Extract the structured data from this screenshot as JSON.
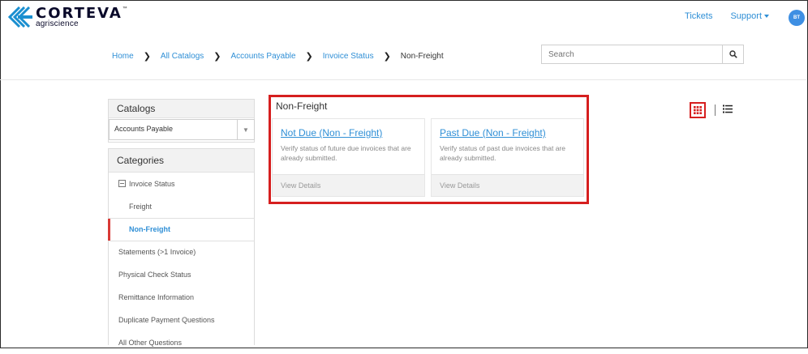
{
  "header": {
    "logo_name": "CORTEVA",
    "logo_tm": "™",
    "logo_sub": "agriscience",
    "tickets": "Tickets",
    "support": "Support",
    "avatar_initials": "BT"
  },
  "breadcrumb": [
    "Home",
    "All Catalogs",
    "Accounts Payable",
    "Invoice Status",
    "Non-Freight"
  ],
  "search": {
    "placeholder": "Search"
  },
  "sidebar": {
    "catalogs_title": "Catalogs",
    "catalog_selected": "Accounts Payable",
    "categories_title": "Categories",
    "items": [
      {
        "label": "Invoice Status"
      },
      {
        "label": "Freight"
      },
      {
        "label": "Non-Freight"
      },
      {
        "label": "Statements (>1 Invoice)"
      },
      {
        "label": "Physical Check Status"
      },
      {
        "label": "Remittance Information"
      },
      {
        "label": "Duplicate Payment Questions"
      },
      {
        "label": "All Other Questions"
      }
    ]
  },
  "main": {
    "section_title": "Non-Freight",
    "cards": [
      {
        "title": "Not Due (Non - Freight)",
        "desc": "Verify status of future due invoices that are already submitted.",
        "footer": "View Details"
      },
      {
        "title": "Past Due (Non - Freight)",
        "desc": "Verify status of past due invoices that are already submitted.",
        "footer": "View Details"
      }
    ]
  },
  "colors": {
    "accent_blue": "#2f8fd6",
    "highlight_red": "#d61f1f",
    "brand_dark": "#0a0a2a"
  },
  "icons": [
    "corteva-logo-icon",
    "search-icon",
    "grid-view-icon",
    "list-view-icon",
    "caret-down-icon",
    "chevron-right-icon",
    "collapse-minus-icon"
  ]
}
